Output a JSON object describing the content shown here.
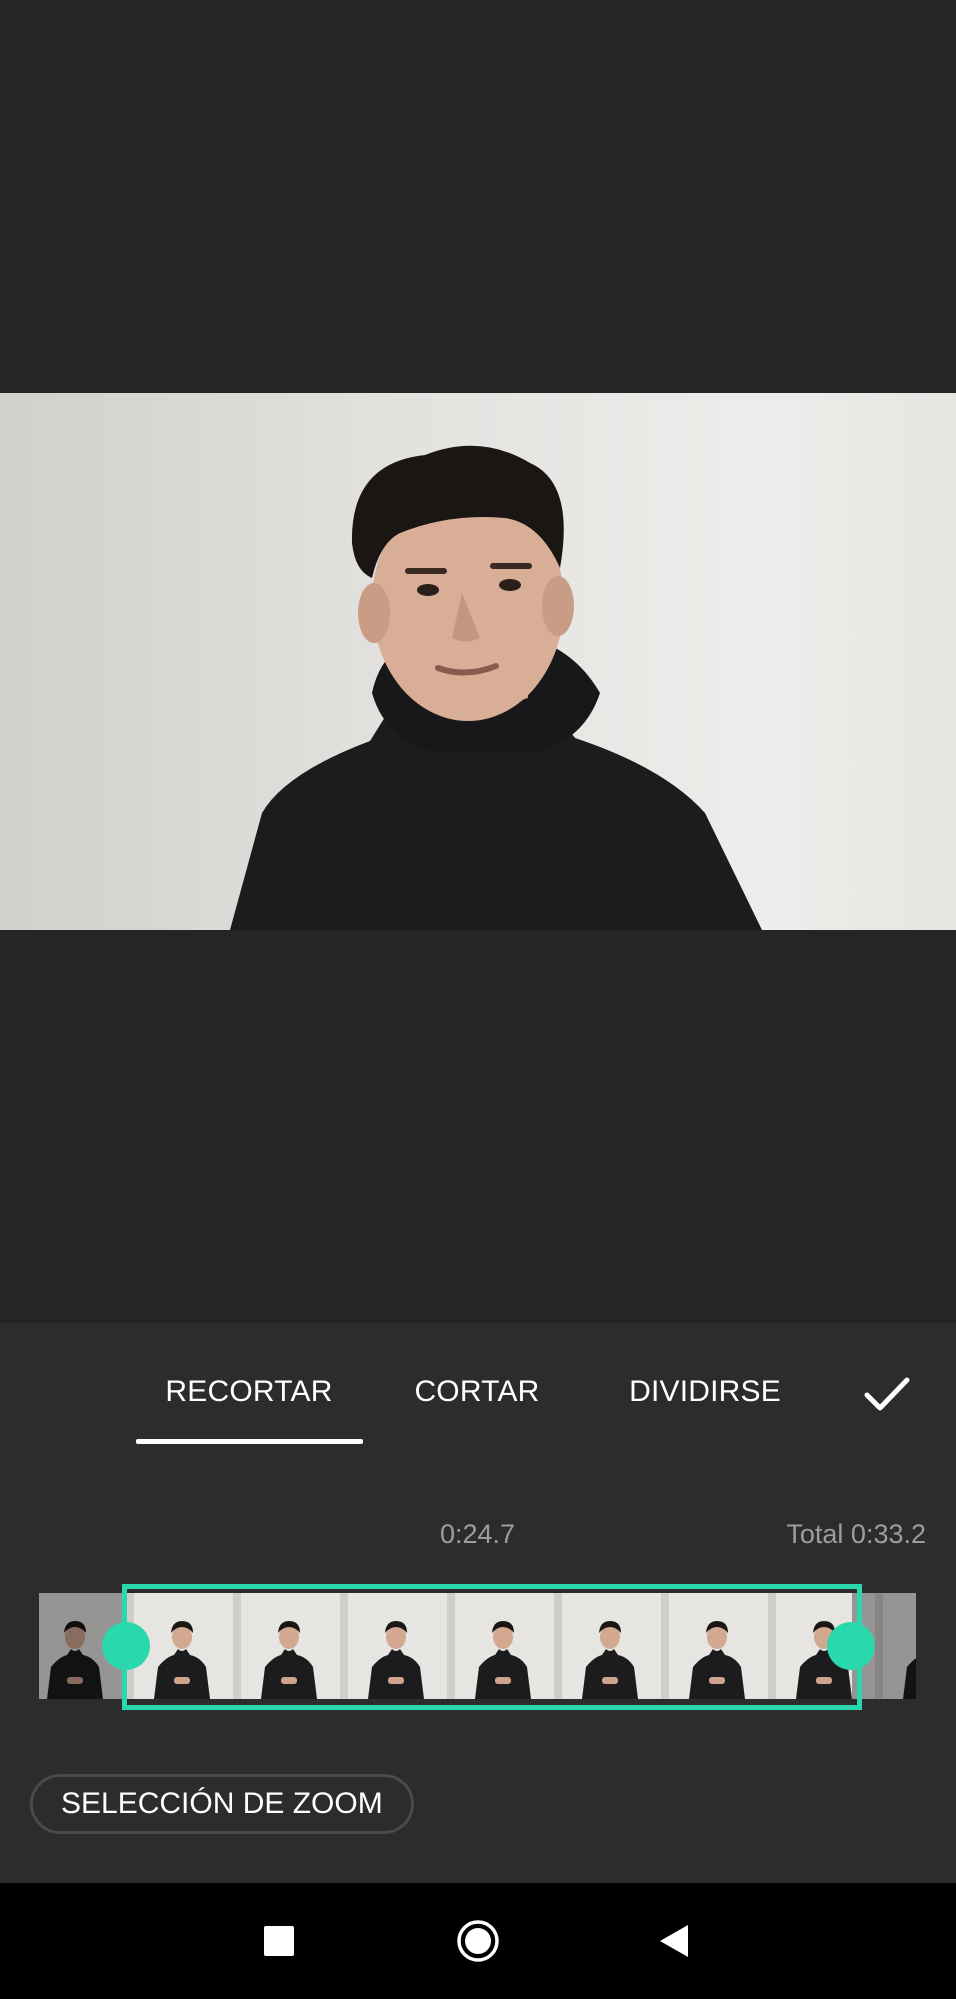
{
  "editor": {
    "tabs": [
      {
        "label": "RECORTAR",
        "selected": true
      },
      {
        "label": "CORTAR",
        "selected": false
      },
      {
        "label": "DIVIDIRSE",
        "selected": false
      }
    ],
    "confirm_icon": "checkmark-icon",
    "current_time": "0:24.7",
    "total_time": "Total 0:33.2",
    "zoom_button_label": "SELECCIÓN DE ZOOM",
    "accent_color": "#2ad8ad"
  },
  "navigation": {
    "recents_icon": "square-icon",
    "home_icon": "circle-icon",
    "back_icon": "triangle-back-icon"
  }
}
